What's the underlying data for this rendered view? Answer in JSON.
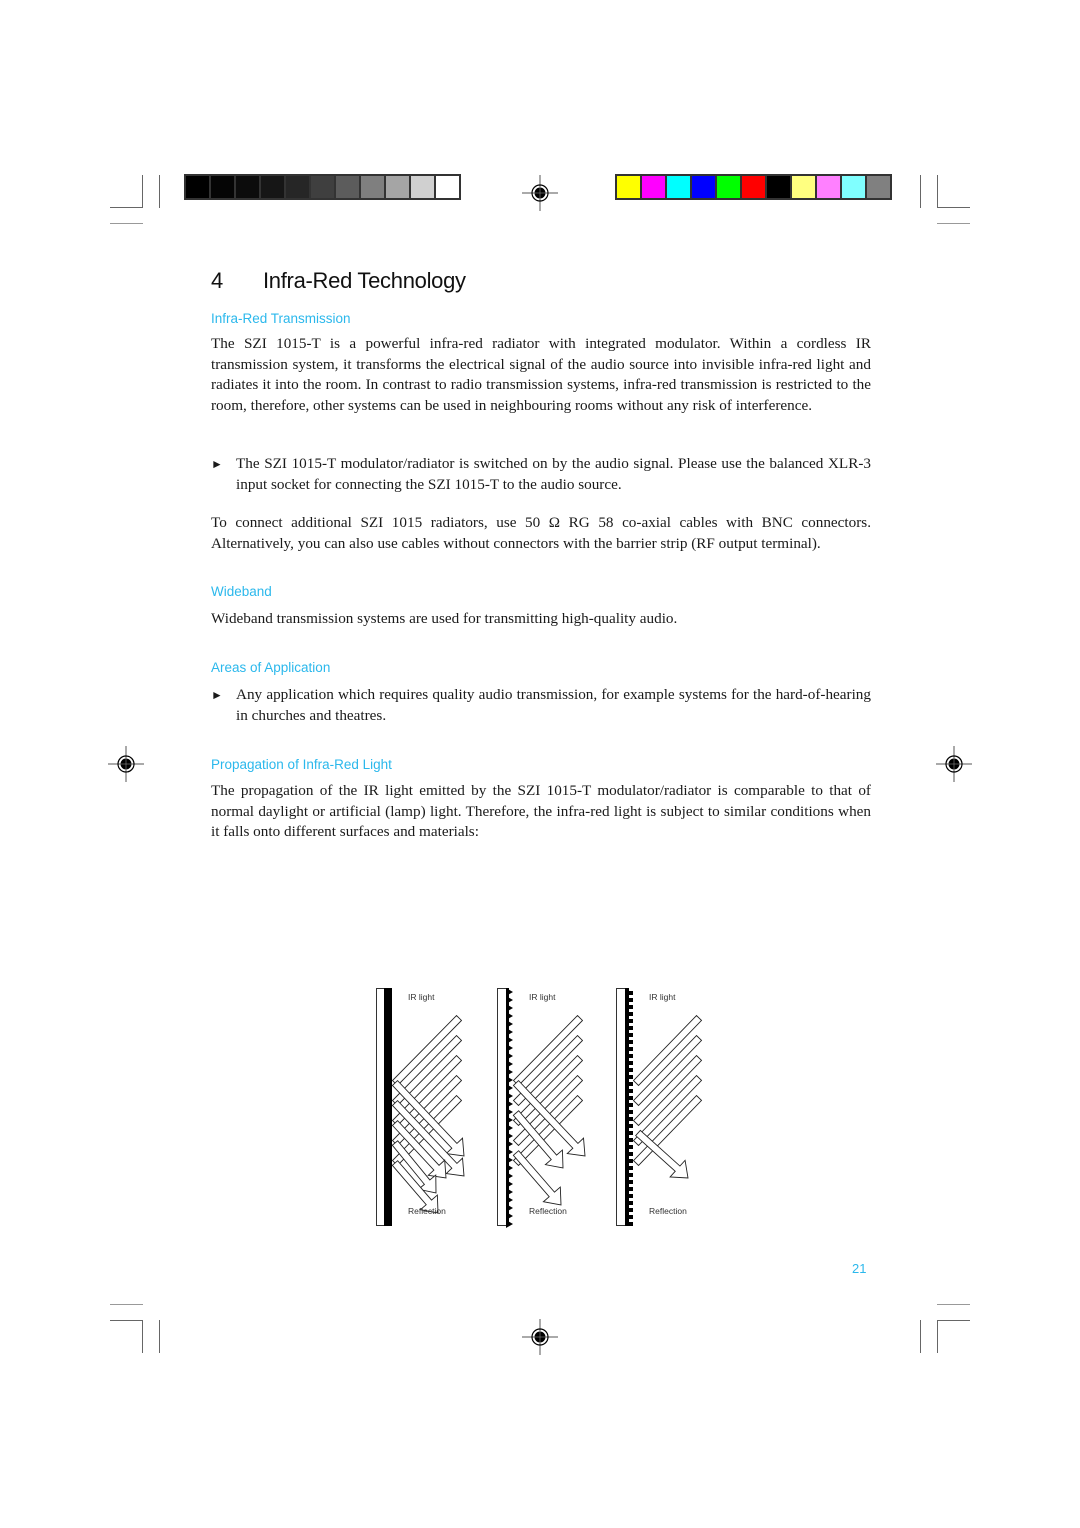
{
  "printer_marks": {
    "grayscale_swatches": [
      "#000000",
      "#050505",
      "#0c0c0c",
      "#161616",
      "#262626",
      "#3f3f3f",
      "#5c5c5c",
      "#7f7f7f",
      "#a5a5a5",
      "#d0d0d0",
      "#ffffff"
    ],
    "color_swatches": [
      "#ffff00",
      "#ff00ff",
      "#00ffff",
      "#0000ff",
      "#00ff00",
      "#ff0000",
      "#000000",
      "#ffff80",
      "#ff80ff",
      "#80ffff",
      "#808080"
    ]
  },
  "chapter": {
    "number": "4",
    "title": "Infra-Red Technology"
  },
  "sections": {
    "transmission": {
      "heading": "Infra-Red Transmission",
      "paragraph": "The SZI 1015-T is a powerful infra-red radiator with integrated modulator. Within a cordless IR transmission system, it transforms the electrical signal of the audio source into invisible infra-red light and radiates it into the room. In contrast to radio transmission systems, infra-red transmission is restricted to the room, therefore, other systems can be used in neighbouring rooms without any risk of interference.",
      "bullet_mark": "►",
      "bullet": "The SZI 1015-T modulator/radiator is switched on by the audio signal. Please use the balanced XLR-3 input socket for connecting the SZI 1015-T to the audio source.",
      "paragraph2": "To connect additional SZI 1015 radiators, use 50 Ω RG 58 co-axial cables with BNC connectors. Alternatively, you can also use cables without connectors with the barrier strip (RF output terminal)."
    },
    "wideband": {
      "heading": "Wideband",
      "paragraph": "Wideband transmission systems are used for transmitting high-quality audio."
    },
    "application": {
      "heading": "Areas of Application",
      "bullet_mark": "►",
      "bullet": "Any application which requires quality audio transmission, for example systems for the hard-of-hearing in churches and theatres."
    },
    "propagation": {
      "heading": "Propagation of Infra-Red Light",
      "paragraph": "The propagation of the IR light emitted by the SZI 1015-T modulator/radiator is comparable to that of normal daylight or artificial (lamp) light. Therefore, the infra-red light is subject to similar conditions when it falls onto different surfaces and materials:"
    }
  },
  "figures": [
    {
      "surface": "smooth",
      "top_label": "IR light",
      "bottom_label": "Reflection"
    },
    {
      "surface": "jagged",
      "top_label": "IR light",
      "bottom_label": "Reflection"
    },
    {
      "surface": "ribbed",
      "top_label": "IR light",
      "bottom_label": "Reflection"
    }
  ],
  "page_number": "21"
}
